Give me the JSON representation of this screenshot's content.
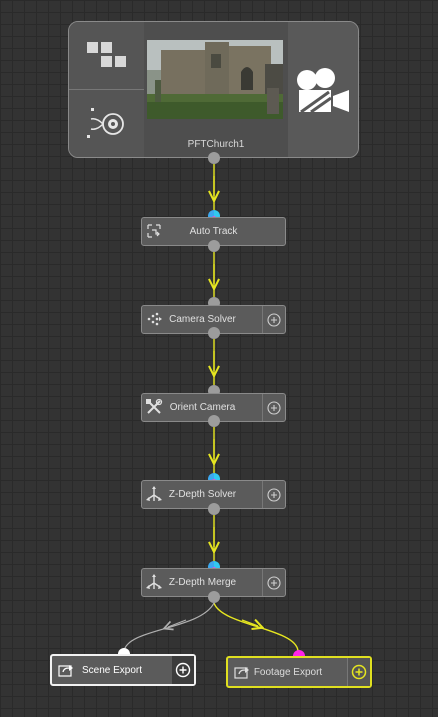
{
  "graph": {
    "clip": {
      "name": "PFTChurch1",
      "thumbnail_alt": "church footage thumbnail"
    },
    "nodes": [
      {
        "label": "Auto Track",
        "icon": "auto-track-icon",
        "has_add": false
      },
      {
        "label": "Camera Solver",
        "icon": "camera-solver-icon",
        "has_add": true
      },
      {
        "label": "Orient Camera",
        "icon": "orient-camera-icon",
        "has_add": true
      },
      {
        "label": "Z-Depth Solver",
        "icon": "z-depth-solver-icon",
        "has_add": true
      },
      {
        "label": "Z-Depth Merge",
        "icon": "z-depth-merge-icon",
        "has_add": true
      }
    ],
    "exports": [
      {
        "label": "Scene Export",
        "icon": "export-icon",
        "selected": true,
        "color": "#ffffff"
      },
      {
        "label": "Footage Export",
        "icon": "export-icon",
        "selected": true,
        "color": "#e6e620"
      }
    ]
  },
  "colors": {
    "background": "#333333",
    "grid_line": "#2a2a2a",
    "wire_footage": "#e6e620",
    "wire_scene": "#b0b0b0",
    "port_default": "#9c9c9c",
    "port_cyan": "#32c8f0",
    "port_magenta": "#ff3ddc"
  }
}
